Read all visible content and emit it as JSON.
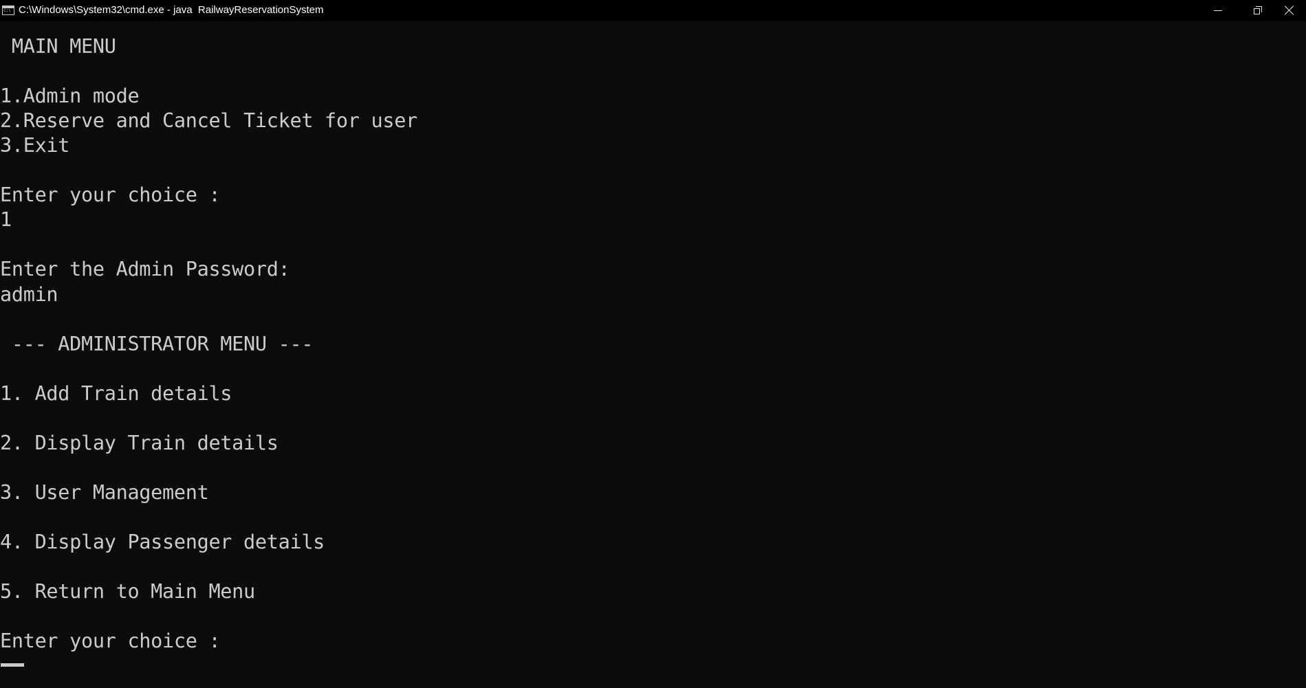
{
  "window": {
    "title": "C:\\Windows\\System32\\cmd.exe - java  RailwayReservationSystem",
    "icon": "cmd-icon",
    "controls": {
      "minimize_icon": "minimize-icon",
      "maximize_icon": "restore-icon",
      "close_icon": "close-icon"
    }
  },
  "colors": {
    "background": "#0c0c0c",
    "text": "#cccccc",
    "titlebar": "#000000"
  },
  "console": {
    "lines": [
      " MAIN MENU",
      "",
      "1.Admin mode",
      "2.Reserve and Cancel Ticket for user",
      "3.Exit",
      "",
      "Enter your choice :",
      "1",
      "",
      "Enter the Admin Password:",
      "admin",
      "",
      " --- ADMINISTRATOR MENU ---",
      "",
      "1. Add Train details",
      "",
      "2. Display Train details",
      "",
      "3. User Management",
      "",
      "4. Display Passenger details",
      "",
      "5. Return to Main Menu",
      "",
      "Enter your choice :"
    ]
  }
}
